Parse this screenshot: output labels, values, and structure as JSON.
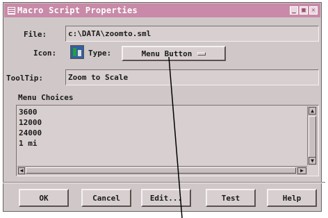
{
  "window": {
    "title": "Macro Script Properties",
    "minimize_glyph": "▁",
    "maximize_glyph": "■",
    "close_glyph": "✕"
  },
  "form": {
    "file_label": "File:",
    "file_value": "c:\\DATA\\zoomto.sml",
    "icon_label": "Icon:",
    "type_label": "Type:",
    "type_value": "Menu Button",
    "tooltip_label": "ToolTip:",
    "tooltip_value": "Zoom to Scale",
    "menu_choices_label": "Menu Choices"
  },
  "menu_choices": [
    "3600",
    "12000",
    "24000",
    "1 mi"
  ],
  "buttons": {
    "ok": "OK",
    "cancel": "Cancel",
    "edit": "Edit...",
    "test": "Test",
    "help": "Help"
  },
  "colors": {
    "titlebar": "#c88aa8",
    "dialog_bg": "#d0c8c8"
  }
}
